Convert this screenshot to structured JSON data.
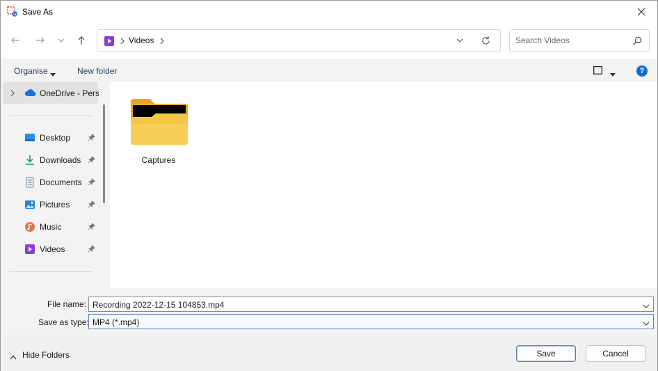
{
  "window": {
    "title": "Save As",
    "close_glyph": "✕"
  },
  "nav": {
    "back_glyph": "←",
    "forward_glyph": "→",
    "recent_glyph": "⌄",
    "up_glyph": "↑"
  },
  "address": {
    "separator": "›",
    "path": [
      "Videos"
    ],
    "icon": "videos-folder-icon"
  },
  "search": {
    "placeholder": "Search Videos"
  },
  "toolbar": {
    "organise_label": "Organise",
    "new_folder_label": "New folder",
    "help_label": "?"
  },
  "navpane": {
    "onedrive_label": "OneDrive - Perso",
    "items": [
      {
        "label": "Desktop",
        "icon": "desktop-icon"
      },
      {
        "label": "Downloads",
        "icon": "download-arrow-icon"
      },
      {
        "label": "Documents",
        "icon": "document-icon"
      },
      {
        "label": "Pictures",
        "icon": "pictures-icon"
      },
      {
        "label": "Music",
        "icon": "music-icon"
      },
      {
        "label": "Videos",
        "icon": "videos-icon"
      }
    ]
  },
  "content": {
    "items": [
      {
        "label": "Captures",
        "type": "folder"
      }
    ]
  },
  "fields": {
    "file_name_label": "File name:",
    "file_name_value": "Recording 2022-12-15 104853.mp4",
    "save_as_type_label": "Save as type:",
    "save_as_type_value": "MP4 (*.mp4)"
  },
  "footer": {
    "hide_folders_label": "Hide Folders",
    "save_label": "Save",
    "cancel_label": "Cancel"
  },
  "colors": {
    "accent": "#0a6cd6",
    "folder_yellow": "#f4c542",
    "dialog_bg": "#f3f3f3"
  }
}
